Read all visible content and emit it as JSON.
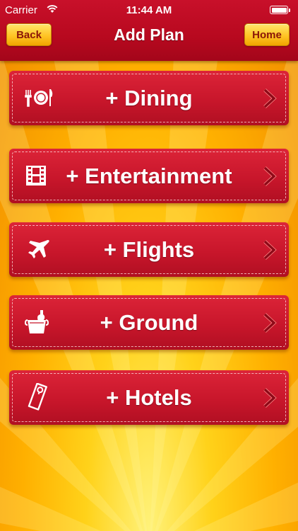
{
  "status_bar": {
    "carrier": "Carrier",
    "time": "11:44 AM"
  },
  "nav": {
    "title": "Add Plan",
    "back_label": "Back",
    "home_label": "Home"
  },
  "menu": {
    "items": [
      {
        "label": "+ Dining",
        "icon": "dining-icon"
      },
      {
        "label": "+ Entertainment",
        "icon": "film-icon"
      },
      {
        "label": "+ Flights",
        "icon": "airplane-icon"
      },
      {
        "label": "+ Ground",
        "icon": "champagne-bucket-icon"
      },
      {
        "label": "+ Hotels",
        "icon": "door-hanger-icon"
      }
    ]
  },
  "colors": {
    "nav_red": "#c8102a",
    "button_red": "#d21d32",
    "nav_button_yellow": "#ffc425",
    "background_yellow": "#ffc200",
    "chevron": "#8e0a18"
  }
}
